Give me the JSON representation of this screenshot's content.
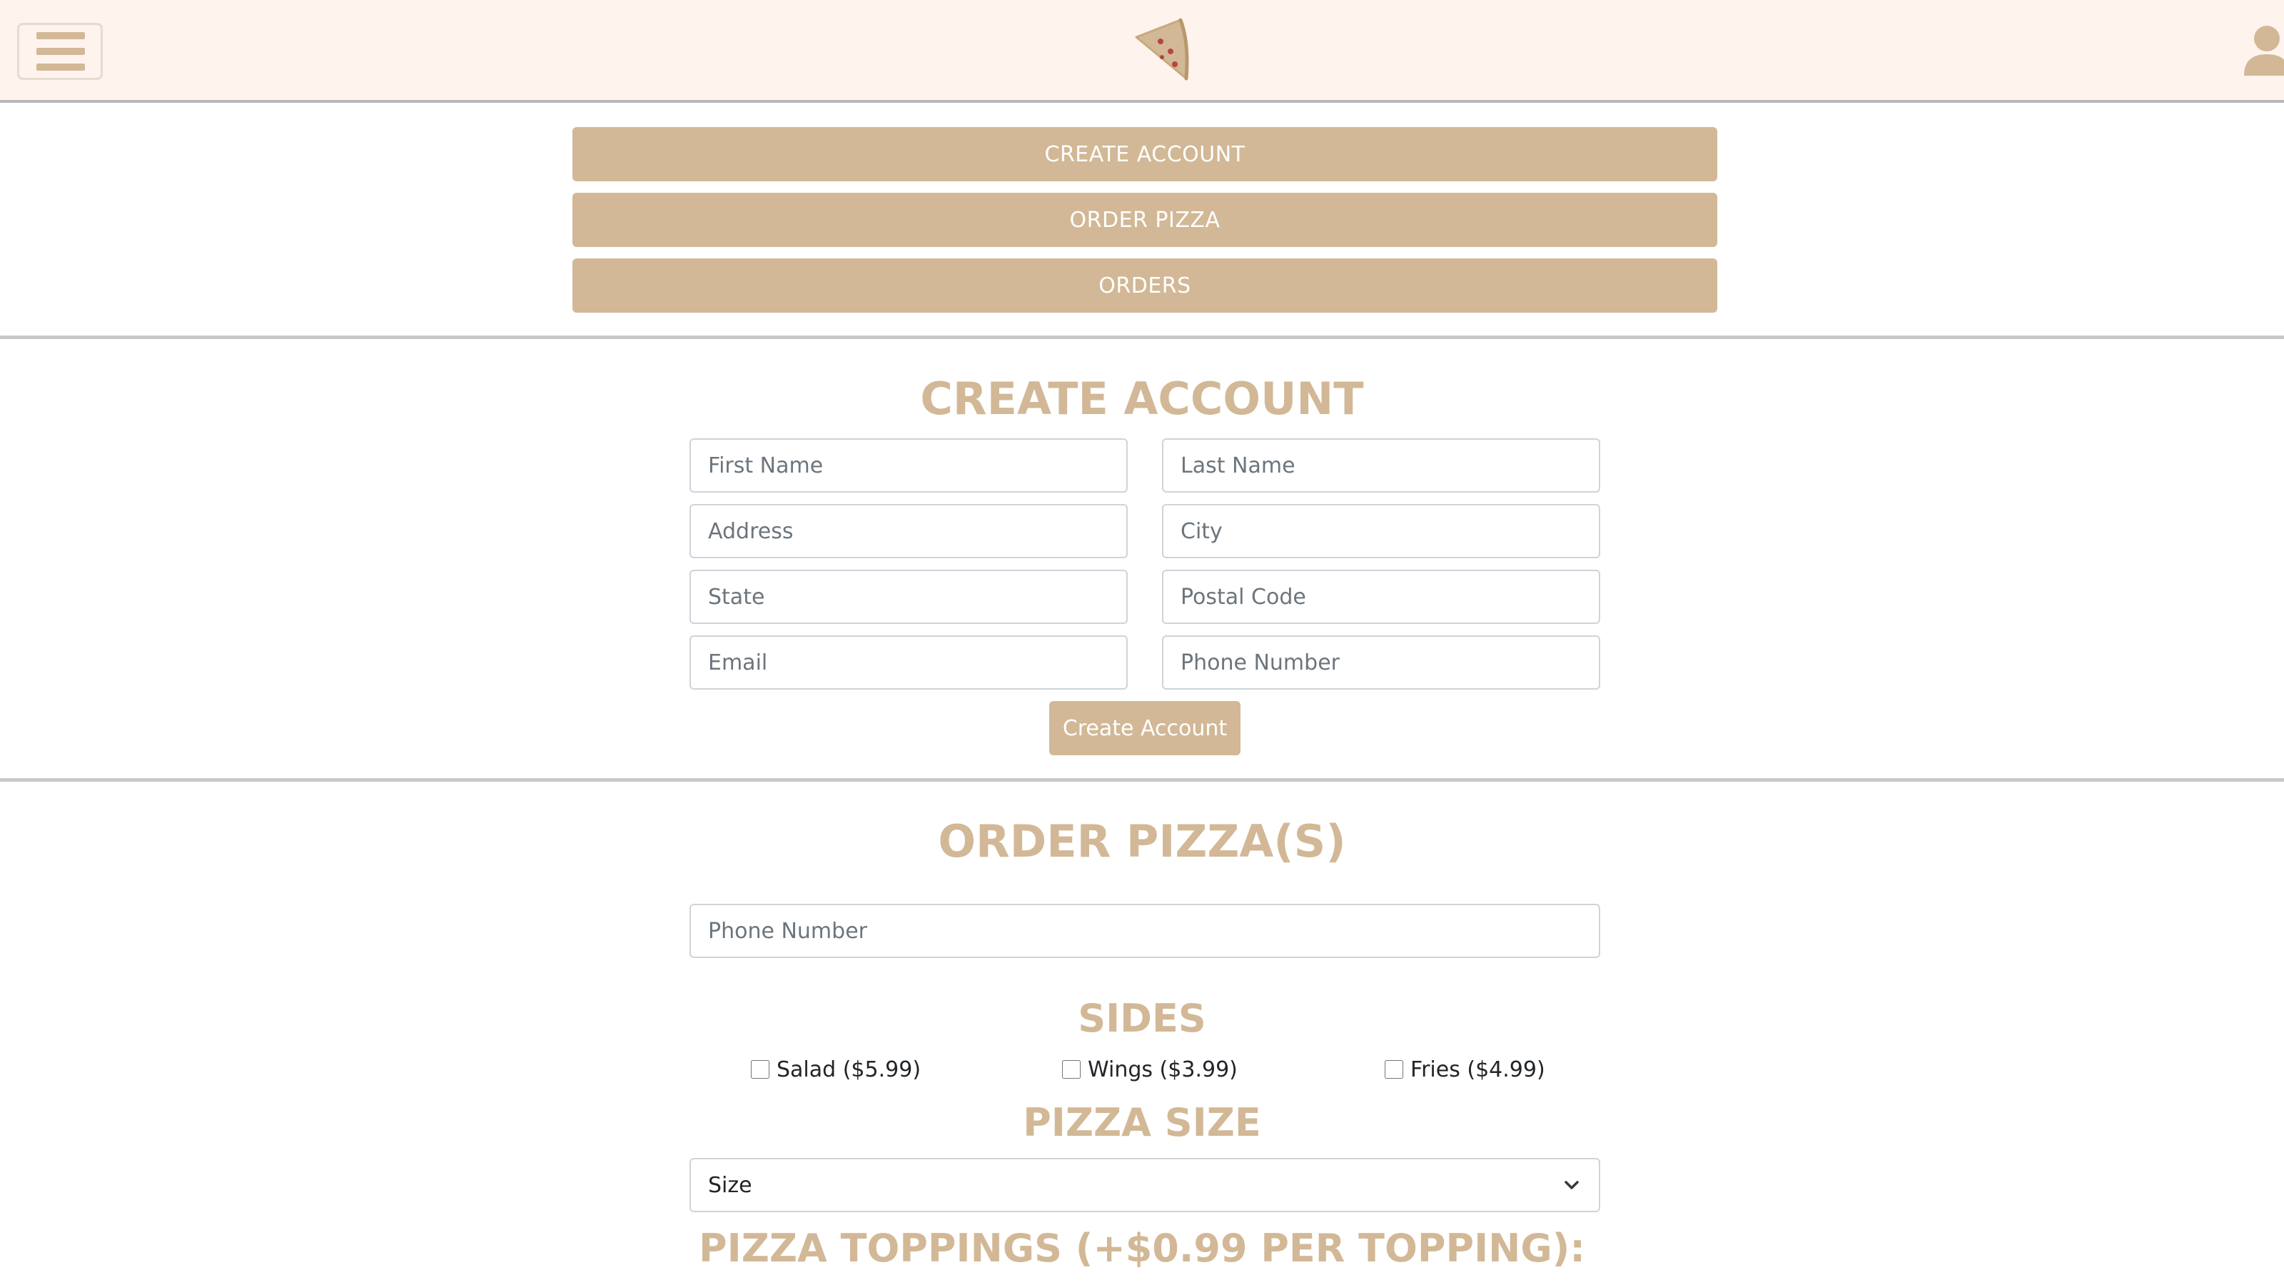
{
  "header": {
    "menu_icon": "hamburger-menu-icon",
    "logo_icon": "pizza-slice-icon",
    "user_icon": "user-icon"
  },
  "nav": {
    "create_account": "CREATE ACCOUNT",
    "order_pizza": "ORDER PIZZA",
    "orders": "ORDERS"
  },
  "create_account": {
    "title": "CREATE ACCOUNT",
    "fields": {
      "first_name": "First Name",
      "last_name": "Last Name",
      "address": "Address",
      "city": "City",
      "state": "State",
      "postal_code": "Postal Code",
      "email": "Email",
      "phone": "Phone Number"
    },
    "submit_label": "Create Account"
  },
  "order": {
    "title": "ORDER PIZZA(S)",
    "phone_placeholder": "Phone Number",
    "sides_title": "SIDES",
    "sides": [
      {
        "label": "Salad ($5.99)",
        "checked": false
      },
      {
        "label": "Wings ($3.99)",
        "checked": false
      },
      {
        "label": "Fries ($4.99)",
        "checked": false
      }
    ],
    "size_title": "PIZZA SIZE",
    "size_value": "Size",
    "toppings_title": "PIZZA TOPPINGS (+$0.99 PER TOPPING):"
  },
  "colors": {
    "accent": "#d2b896",
    "header_bg": "#fff3ee",
    "pepperoni": "#b5473d"
  }
}
